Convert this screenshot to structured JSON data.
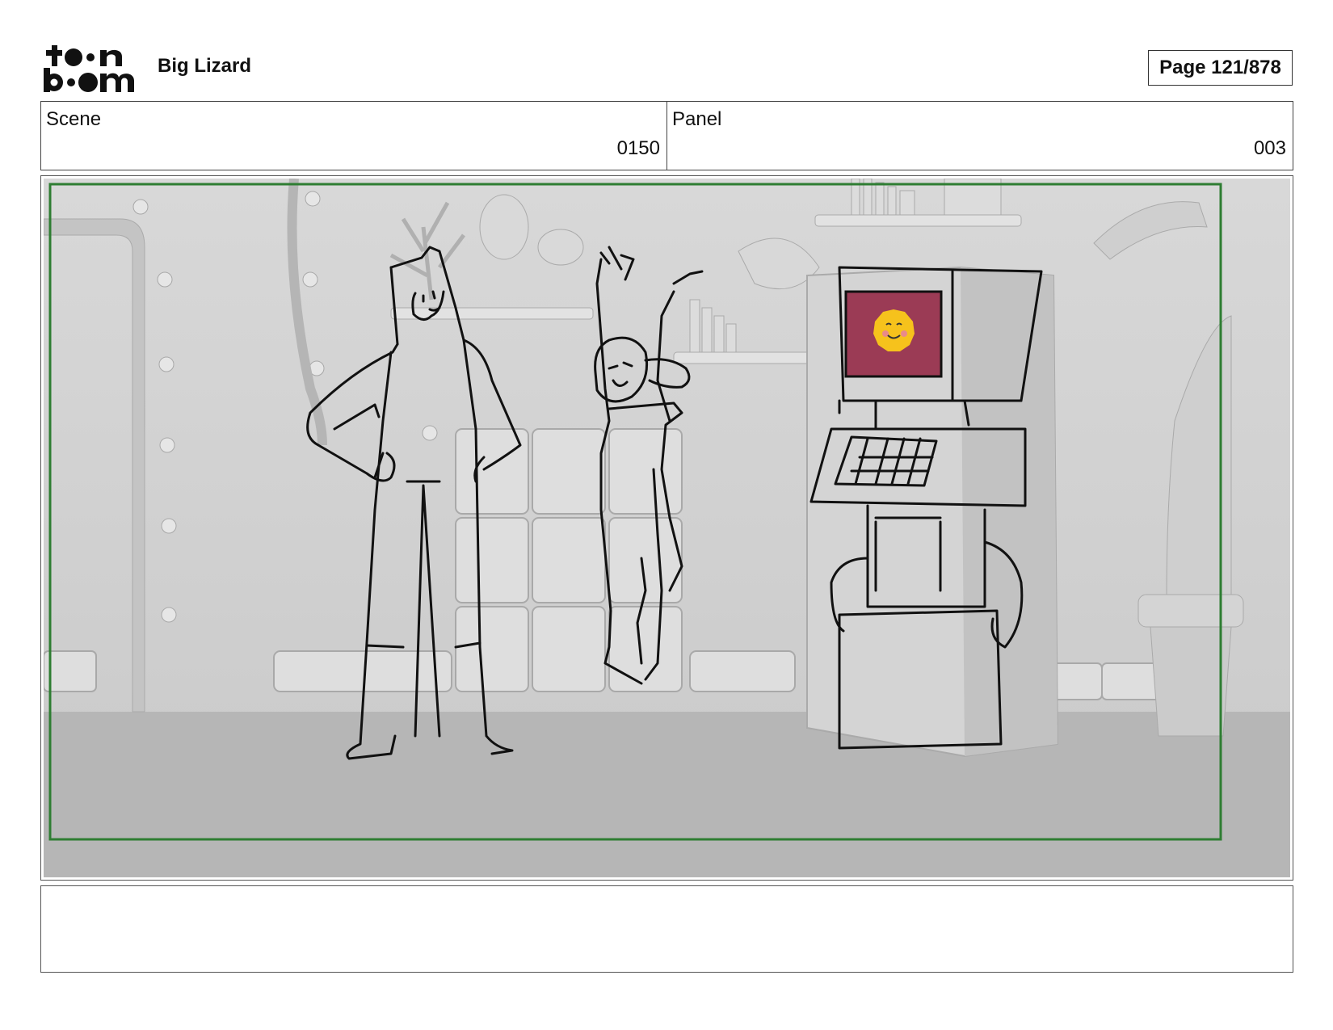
{
  "header": {
    "logo_text_top": "toon",
    "logo_text_bottom": "boom",
    "project_title": "Big Lizard",
    "page_label": "Page 121/878"
  },
  "info": {
    "scene_label": "Scene",
    "scene_value": "0150",
    "panel_label": "Panel",
    "panel_value": "003"
  },
  "panel_image": {
    "description_icon": "storyboard-sketch",
    "frame_color": "#2e7d32",
    "screen_color": "#9b3b55",
    "face_color": "#f6c21c"
  },
  "notes": {
    "text": ""
  }
}
